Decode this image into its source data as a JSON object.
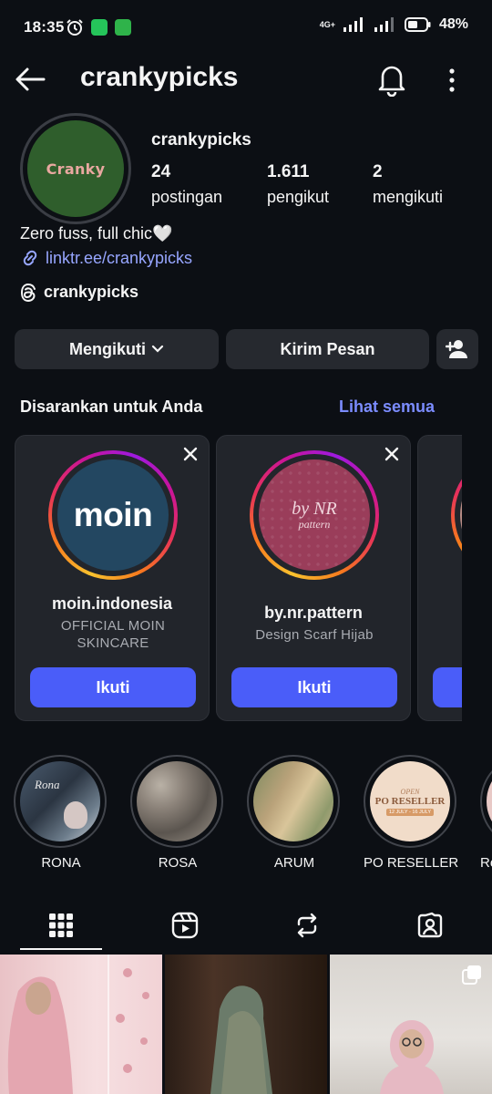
{
  "status_bar": {
    "time": "18:35",
    "network": "4G+",
    "battery": "48%"
  },
  "header": {
    "username": "crankypicks"
  },
  "profile": {
    "avatar_text": "Cranky",
    "display_name": "crankypicks",
    "stats": [
      {
        "value": "24",
        "label": "postingan"
      },
      {
        "value": "1.611",
        "label": "pengikut"
      },
      {
        "value": "2",
        "label": "mengikuti"
      }
    ],
    "bio": "Zero fuss, full chic🤍",
    "link": "linktr.ee/crankypicks",
    "threads": "crankypicks"
  },
  "actions": {
    "following": "Mengikuti",
    "message": "Kirim Pesan"
  },
  "suggested": {
    "title": "Disarankan untuk Anda",
    "see_all": "Lihat semua",
    "cards": [
      {
        "name": "moin.indonesia",
        "subtitle": "OFFICIAL MOIN SKINCARE",
        "avatar_text": "moin",
        "button": "Ikuti"
      },
      {
        "name": "by.nr.pattern",
        "subtitle": "Design Scarf Hijab",
        "avatar_text": "by NR",
        "avatar_text2": "pattern",
        "button": "Ikuti"
      }
    ]
  },
  "highlights": [
    {
      "label": "RONA",
      "image_text": "Rona"
    },
    {
      "label": "ROSA"
    },
    {
      "label": "ARUM"
    },
    {
      "label": "PO RESELLER",
      "image_text": "PO RESELLER",
      "image_sub": "12 JULY - 16 JULY",
      "image_top": "OPEN"
    },
    {
      "label": "Re"
    }
  ],
  "tabs": [
    "grid-icon",
    "reels-icon",
    "reposts-icon",
    "tagged-icon"
  ],
  "colors": {
    "background": "#0c0f14",
    "button": "#26292f",
    "accent_blue": "#4a5df9",
    "link": "#97a6ff"
  }
}
